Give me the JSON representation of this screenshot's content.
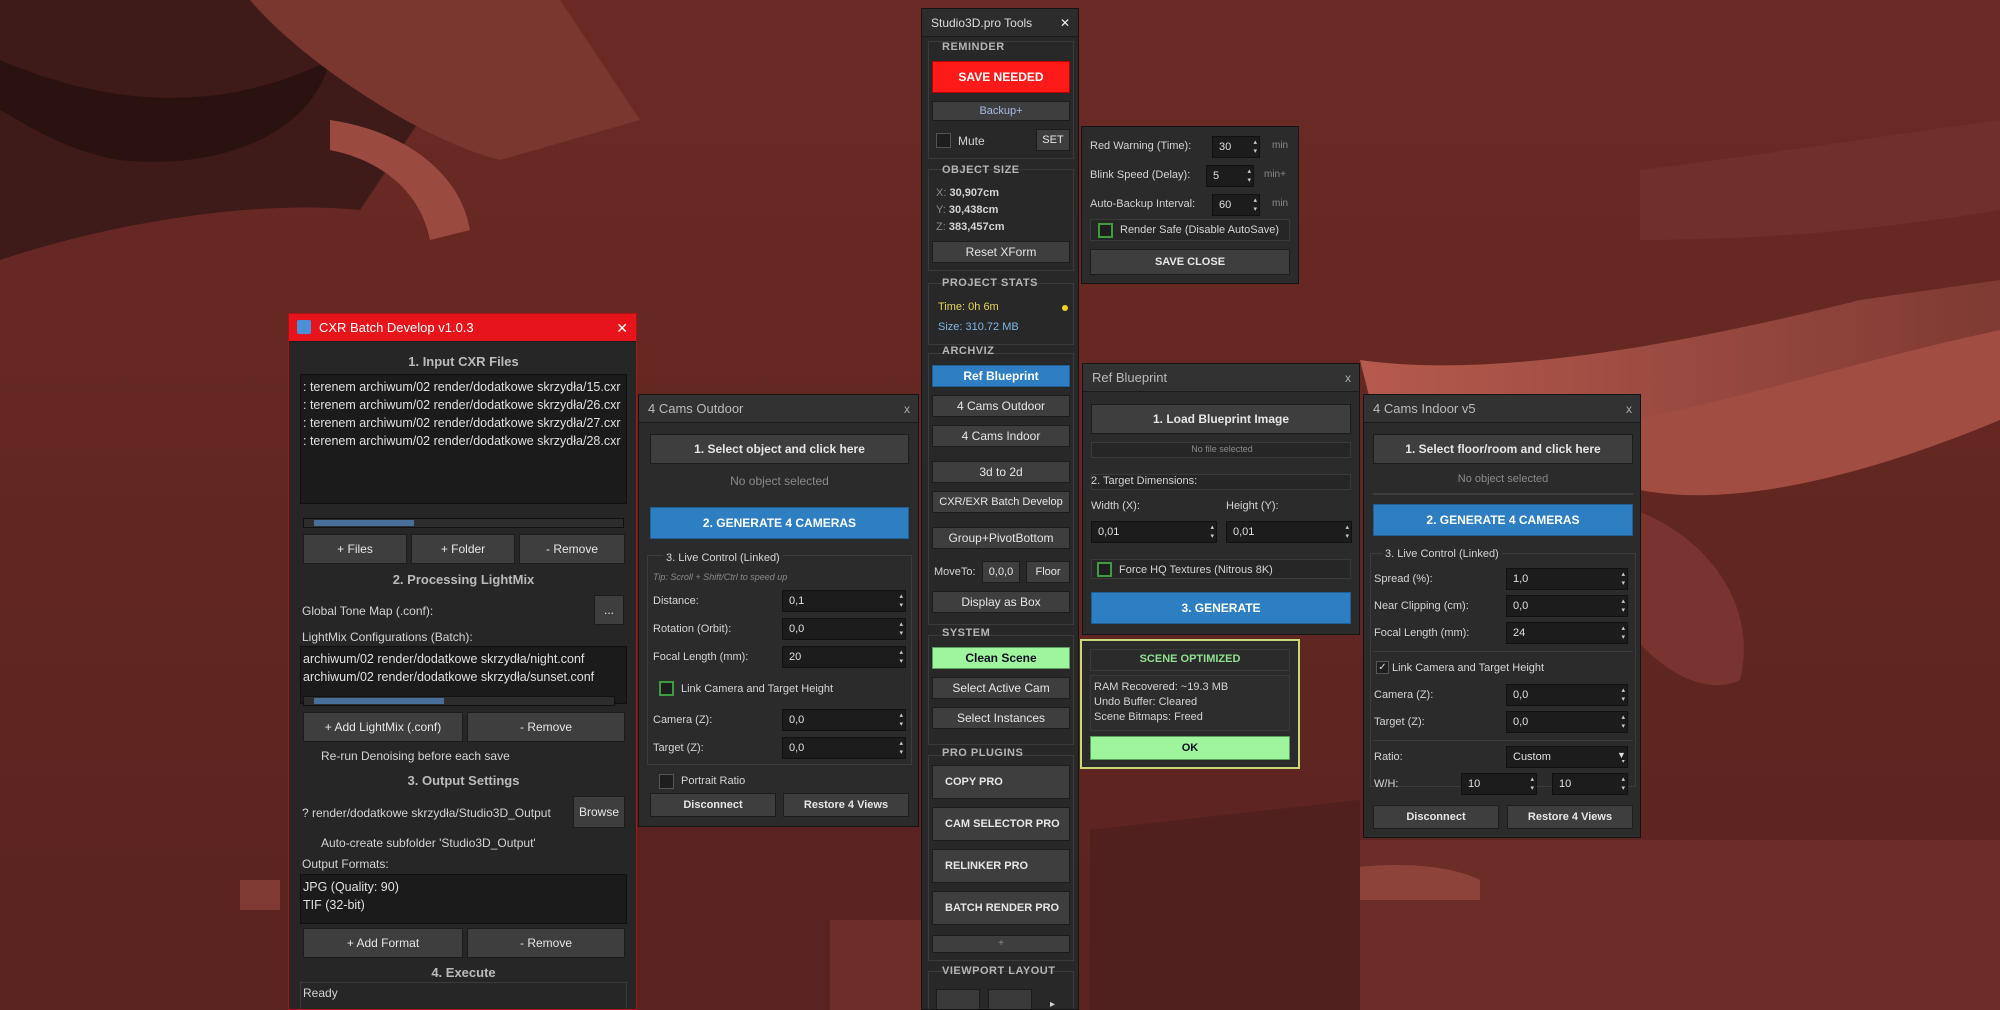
{
  "colors": {
    "accent": "#2d7fc1",
    "danger": "#ff1a1a",
    "success": "#9ef59e",
    "titlebar_red": "#e8141c"
  },
  "studio": {
    "title": "Studio3D.pro Tools",
    "close": "✕",
    "reminder_label": "REMINDER",
    "save_needed": "SAVE NEEDED",
    "backup": "Backup+",
    "mute": "Mute",
    "set": "SET",
    "object_size_label": "OBJECT SIZE",
    "x_key": "X:",
    "x_val": "30,907cm",
    "y_key": "Y:",
    "y_val": "30,438cm",
    "z_key": "Z:",
    "z_val": "383,457cm",
    "reset_xform": "Reset XForm",
    "project_stats_label": "PROJECT STATS",
    "time": "Time: 0h 6m",
    "size": "Size: 310.72 MB",
    "archviz_label": "ARCHVIZ",
    "ref_blueprint": "Ref Blueprint",
    "cams_outdoor": "4 Cams Outdoor",
    "cams_indoor": "4 Cams Indoor",
    "to2d": "3d to 2d",
    "batch_develop": "CXR/EXR Batch Develop",
    "group_pivot": "Group+PivotBottom",
    "moveto": "MoveTo:",
    "moveto_val": "0,0,0",
    "floor": "Floor",
    "display_box": "Display as Box",
    "system_label": "SYSTEM",
    "clean_scene": "Clean Scene",
    "select_active_cam": "Select Active Cam",
    "select_instances": "Select Instances",
    "pro_plugins_label": "PRO PLUGINS",
    "copy_pro": "COPY PRO",
    "cam_selector_pro": "CAM SELECTOR PRO",
    "relinker_pro": "RELINKER PRO",
    "batch_render_pro": "BATCH RENDER PRO",
    "more": "+",
    "viewport_layout_label": "VIEWPORT LAYOUT",
    "viewport_arrow": "▸"
  },
  "reminder_settings": {
    "red_warning": "Red Warning (Time):",
    "red_warning_val": "30",
    "min1": "min",
    "blink": "Blink Speed (Delay):",
    "blink_val": "5",
    "min_plus": "min+",
    "auto_backup": "Auto-Backup Interval:",
    "auto_backup_val": "60",
    "min2": "min",
    "render_safe": "Render Safe (Disable AutoSave)",
    "save_close": "SAVE  CLOSE"
  },
  "cxr": {
    "title": "CXR Batch Develop v1.0.3",
    "close": "✕",
    "input_header": "1. Input CXR Files",
    "files": [
      ": terenem archiwum/02 render/dodatkowe skrzydła/15.cxr",
      ": terenem archiwum/02 render/dodatkowe skrzydła/26.cxr",
      ": terenem archiwum/02 render/dodatkowe skrzydła/27.cxr",
      ": terenem archiwum/02 render/dodatkowe skrzydła/28.cxr"
    ],
    "add_files": "+ Files",
    "add_folder": "+ Folder",
    "remove": "- Remove",
    "processing_header": "2. Processing  LightMix",
    "tone_map": "Global Tone Map (.conf):",
    "dots": "...",
    "lightmix_label": "LightMix Configurations (Batch):",
    "lightmix": [
      "archiwum/02 render/dodatkowe skrzydła/night.conf",
      "archiwum/02 render/dodatkowe skrzydła/sunset.conf"
    ],
    "add_lightmix": "+ Add LightMix (.conf)",
    "remove_lightmix": "- Remove",
    "rerun": "Re-run Denoising before each save",
    "output_header": "3. Output Settings",
    "output_path": "? render/dodatkowe skrzydła/Studio3D_Output",
    "browse": "Browse",
    "auto_create": "Auto-create subfolder 'Studio3D_Output'",
    "formats_label": "Output Formats:",
    "formats": [
      "JPG (Quality: 90)",
      "TIF (32-bit)"
    ],
    "add_format": "+ Add Format",
    "remove_format": "- Remove",
    "execute_header": "4. Execute",
    "status": "Ready"
  },
  "outdoor": {
    "title": "4 Cams Outdoor",
    "close": "x",
    "select": "1. Select object and click here",
    "status": "No object selected",
    "generate": "2. GENERATE 4 CAMERAS",
    "live_header": "3. Live Control (Linked)",
    "tip": "Tip: Scroll + Shift/Ctrl to speed up",
    "distance": "Distance:",
    "distance_val": "0,1",
    "rotation": "Rotation (Orbit):",
    "rotation_val": "0,0",
    "focal": "Focal Length (mm):",
    "focal_val": "20",
    "link": "Link Camera and Target Height",
    "camera_z": "Camera (Z):",
    "camera_z_val": "0,0",
    "target_z": "Target (Z):",
    "target_z_val": "0,0",
    "portrait": "Portrait Ratio",
    "disconnect": "Disconnect",
    "restore": "Restore 4 Views"
  },
  "blueprint": {
    "title": "Ref Blueprint",
    "close": "x",
    "load": "1. Load Blueprint Image",
    "no_file": "No file selected",
    "target_dims": "2. Target Dimensions:",
    "width": "Width (X):",
    "height": "Height (Y):",
    "width_val": "0,01",
    "height_val": "0,01",
    "force_hq": "Force HQ Textures (Nitrous 8K)",
    "generate": "3. GENERATE"
  },
  "optimized": {
    "title": "SCENE OPTIMIZED",
    "lines": [
      "RAM Recovered: ~19.3 MB",
      "Undo Buffer: Cleared",
      "Scene Bitmaps: Freed"
    ],
    "ok": "OK"
  },
  "indoor": {
    "title": "4 Cams Indoor v5",
    "close": "x",
    "select": "1. Select floor/room and click here",
    "status": "No object selected",
    "generate": "2. GENERATE 4 CAMERAS",
    "live_header": "3. Live Control (Linked)",
    "spread": "Spread (%):",
    "spread_val": "1,0",
    "near": "Near Clipping (cm):",
    "near_val": "0,0",
    "focal": "Focal Length (mm):",
    "focal_val": "24",
    "link": "Link Camera and Target Height",
    "camera_z": "Camera (Z):",
    "camera_z_val": "0,0",
    "target_z": "Target (Z):",
    "target_z_val": "0,0",
    "ratio": "Ratio:",
    "ratio_val": "Custom",
    "wh": "W/H:",
    "w_val": "10",
    "h_val": "10",
    "disconnect": "Disconnect",
    "restore": "Restore 4 Views"
  }
}
